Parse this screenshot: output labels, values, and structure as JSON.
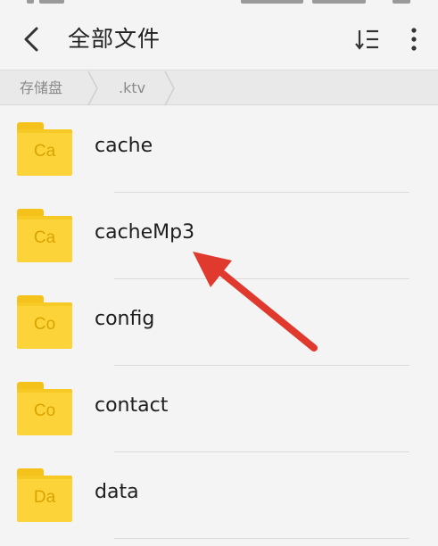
{
  "header": {
    "title": "全部文件",
    "back_icon": "chevron-left-icon",
    "sort_icon": "sort-list-icon",
    "more_icon": "more-vertical-icon"
  },
  "breadcrumb": {
    "items": [
      "存储盘",
      ".ktv"
    ]
  },
  "files": [
    {
      "name": "cache",
      "abbr": "Ca"
    },
    {
      "name": "cacheMp3",
      "abbr": "Ca"
    },
    {
      "name": "config",
      "abbr": "Co"
    },
    {
      "name": "contact",
      "abbr": "Co"
    },
    {
      "name": "data",
      "abbr": "Da"
    }
  ],
  "colors": {
    "folder": "#fdd33a",
    "folder_text": "#d9a300",
    "arrow": "#e0392e",
    "background": "#f4f4f4"
  }
}
